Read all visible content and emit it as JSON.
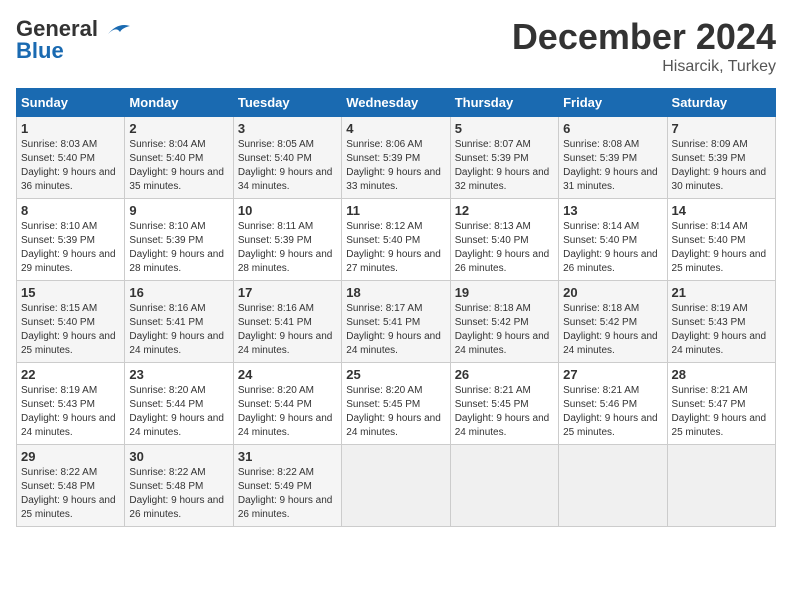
{
  "logo": {
    "line1": "General",
    "line2": "Blue"
  },
  "title": "December 2024",
  "subtitle": "Hisarcik, Turkey",
  "days_of_week": [
    "Sunday",
    "Monday",
    "Tuesday",
    "Wednesday",
    "Thursday",
    "Friday",
    "Saturday"
  ],
  "weeks": [
    [
      {
        "day": 1,
        "info": "Sunrise: 8:03 AM\nSunset: 5:40 PM\nDaylight: 9 hours and 36 minutes."
      },
      {
        "day": 2,
        "info": "Sunrise: 8:04 AM\nSunset: 5:40 PM\nDaylight: 9 hours and 35 minutes."
      },
      {
        "day": 3,
        "info": "Sunrise: 8:05 AM\nSunset: 5:40 PM\nDaylight: 9 hours and 34 minutes."
      },
      {
        "day": 4,
        "info": "Sunrise: 8:06 AM\nSunset: 5:39 PM\nDaylight: 9 hours and 33 minutes."
      },
      {
        "day": 5,
        "info": "Sunrise: 8:07 AM\nSunset: 5:39 PM\nDaylight: 9 hours and 32 minutes."
      },
      {
        "day": 6,
        "info": "Sunrise: 8:08 AM\nSunset: 5:39 PM\nDaylight: 9 hours and 31 minutes."
      },
      {
        "day": 7,
        "info": "Sunrise: 8:09 AM\nSunset: 5:39 PM\nDaylight: 9 hours and 30 minutes."
      }
    ],
    [
      {
        "day": 8,
        "info": "Sunrise: 8:10 AM\nSunset: 5:39 PM\nDaylight: 9 hours and 29 minutes."
      },
      {
        "day": 9,
        "info": "Sunrise: 8:10 AM\nSunset: 5:39 PM\nDaylight: 9 hours and 28 minutes."
      },
      {
        "day": 10,
        "info": "Sunrise: 8:11 AM\nSunset: 5:39 PM\nDaylight: 9 hours and 28 minutes."
      },
      {
        "day": 11,
        "info": "Sunrise: 8:12 AM\nSunset: 5:40 PM\nDaylight: 9 hours and 27 minutes."
      },
      {
        "day": 12,
        "info": "Sunrise: 8:13 AM\nSunset: 5:40 PM\nDaylight: 9 hours and 26 minutes."
      },
      {
        "day": 13,
        "info": "Sunrise: 8:14 AM\nSunset: 5:40 PM\nDaylight: 9 hours and 26 minutes."
      },
      {
        "day": 14,
        "info": "Sunrise: 8:14 AM\nSunset: 5:40 PM\nDaylight: 9 hours and 25 minutes."
      }
    ],
    [
      {
        "day": 15,
        "info": "Sunrise: 8:15 AM\nSunset: 5:40 PM\nDaylight: 9 hours and 25 minutes."
      },
      {
        "day": 16,
        "info": "Sunrise: 8:16 AM\nSunset: 5:41 PM\nDaylight: 9 hours and 24 minutes."
      },
      {
        "day": 17,
        "info": "Sunrise: 8:16 AM\nSunset: 5:41 PM\nDaylight: 9 hours and 24 minutes."
      },
      {
        "day": 18,
        "info": "Sunrise: 8:17 AM\nSunset: 5:41 PM\nDaylight: 9 hours and 24 minutes."
      },
      {
        "day": 19,
        "info": "Sunrise: 8:18 AM\nSunset: 5:42 PM\nDaylight: 9 hours and 24 minutes."
      },
      {
        "day": 20,
        "info": "Sunrise: 8:18 AM\nSunset: 5:42 PM\nDaylight: 9 hours and 24 minutes."
      },
      {
        "day": 21,
        "info": "Sunrise: 8:19 AM\nSunset: 5:43 PM\nDaylight: 9 hours and 24 minutes."
      }
    ],
    [
      {
        "day": 22,
        "info": "Sunrise: 8:19 AM\nSunset: 5:43 PM\nDaylight: 9 hours and 24 minutes."
      },
      {
        "day": 23,
        "info": "Sunrise: 8:20 AM\nSunset: 5:44 PM\nDaylight: 9 hours and 24 minutes."
      },
      {
        "day": 24,
        "info": "Sunrise: 8:20 AM\nSunset: 5:44 PM\nDaylight: 9 hours and 24 minutes."
      },
      {
        "day": 25,
        "info": "Sunrise: 8:20 AM\nSunset: 5:45 PM\nDaylight: 9 hours and 24 minutes."
      },
      {
        "day": 26,
        "info": "Sunrise: 8:21 AM\nSunset: 5:45 PM\nDaylight: 9 hours and 24 minutes."
      },
      {
        "day": 27,
        "info": "Sunrise: 8:21 AM\nSunset: 5:46 PM\nDaylight: 9 hours and 25 minutes."
      },
      {
        "day": 28,
        "info": "Sunrise: 8:21 AM\nSunset: 5:47 PM\nDaylight: 9 hours and 25 minutes."
      }
    ],
    [
      {
        "day": 29,
        "info": "Sunrise: 8:22 AM\nSunset: 5:48 PM\nDaylight: 9 hours and 25 minutes."
      },
      {
        "day": 30,
        "info": "Sunrise: 8:22 AM\nSunset: 5:48 PM\nDaylight: 9 hours and 26 minutes."
      },
      {
        "day": 31,
        "info": "Sunrise: 8:22 AM\nSunset: 5:49 PM\nDaylight: 9 hours and 26 minutes."
      },
      null,
      null,
      null,
      null
    ]
  ]
}
